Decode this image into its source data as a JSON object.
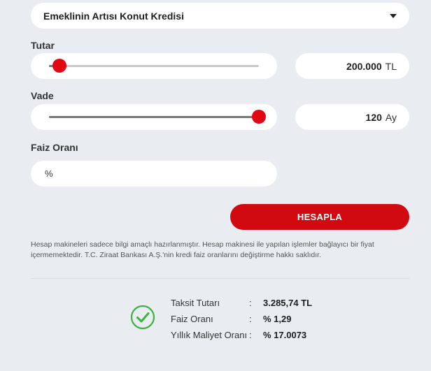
{
  "credit_select": {
    "value": "Emeklinin Artısı Konut Kredisi"
  },
  "tutar": {
    "label": "Tutar",
    "value": "200.000",
    "unit": "TL",
    "slider_fraction": 0.05
  },
  "vade": {
    "label": "Vade",
    "value": "120",
    "unit": "Ay",
    "slider_fraction": 1.0
  },
  "faiz": {
    "label": "Faiz Oranı",
    "placeholder": "%"
  },
  "calculate_label": "HESAPLA",
  "disclaimer": "Hesap makineleri sadece bilgi amaçlı hazırlanmıştır. Hesap makinesi ile yapılan işlemler bağlayıcı bir fiyat içermemektedir. T.C. Ziraat Bankası A.Ş.'nin kredi faiz oranlarını değiştirme hakkı saklıdır.",
  "results": [
    {
      "label": "Taksit Tutarı",
      "sep": ":",
      "value": "3.285,74 TL"
    },
    {
      "label": "Faiz Oranı",
      "sep": ":",
      "value": "% 1,29"
    },
    {
      "label": "Yıllık Maliyet Oranı",
      "sep": ":",
      "value": "% 17.0073"
    }
  ],
  "colors": {
    "accent": "#d10a11",
    "success": "#3cb33c",
    "background": "#e9edf1"
  }
}
